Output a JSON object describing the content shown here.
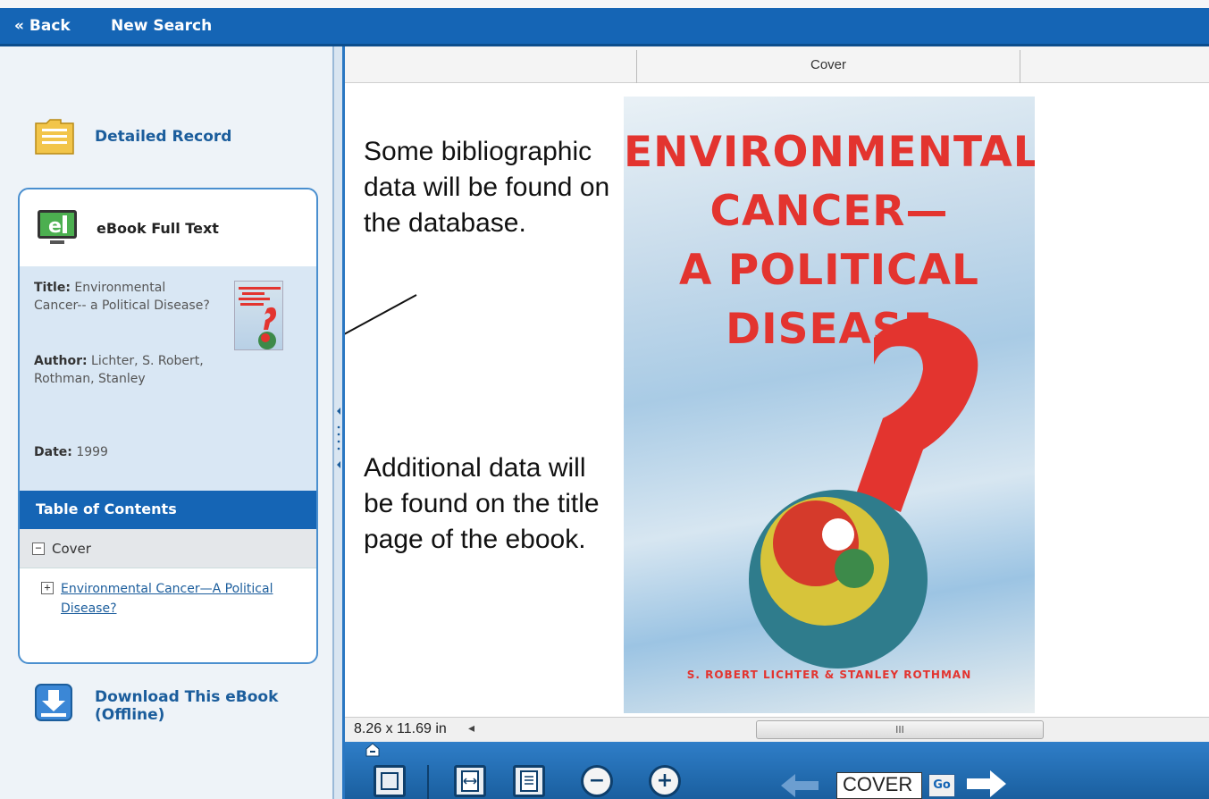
{
  "topnav": {
    "back_label": "« Back",
    "new_search_label": "New Search"
  },
  "sidebar": {
    "detailed_record_label": "Detailed Record",
    "panel_title": "eBook Full Text",
    "metadata": {
      "title_label": "Title:",
      "title_value": "Environmental Cancer-- a Political Disease?",
      "author_label": "Author:",
      "author_value": "Lichter, S. Robert, Rothman, Stanley",
      "date_label": "Date:",
      "date_value": "1999"
    },
    "toc_header": "Table of Contents",
    "toc": [
      {
        "label": "Cover",
        "state": "expanded",
        "sign": "−"
      },
      {
        "label": "Environmental Cancer—A Political Disease?",
        "state": "collapsed",
        "sign": "+"
      }
    ],
    "download_label": "Download This eBook (Offline)"
  },
  "viewer": {
    "header_tab": "Cover",
    "book_cover": {
      "title_lines": "ENVIRONMENTAL\nCANCER—\nA POLITICAL\nDISEASE",
      "authors": "S. ROBERT LICHTER & STANLEY ROTHMAN",
      "accent_color": "#e3342f"
    },
    "callouts": {
      "top": "Some bibliographic data will be found on the database.",
      "bottom": "Additional data will be found on the title page of the ebook."
    },
    "page_size": "8.26 x 11.69 in",
    "scroll_thumb_label": "III",
    "page_field_value": "COVER",
    "go_label": "Go"
  },
  "colors": {
    "brand_blue": "#1565b5",
    "link_blue": "#1b5d9c",
    "panel_bg": "#d9e7f4"
  }
}
